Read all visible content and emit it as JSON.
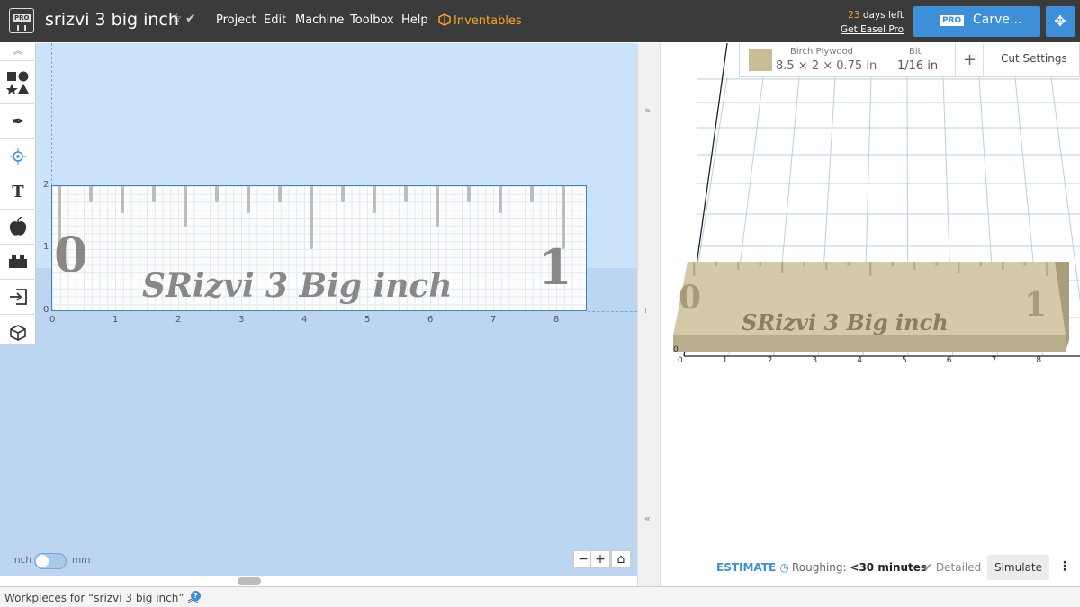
{
  "header": {
    "logo_badge": "PRO",
    "project_title": "srizvi 3 big inch",
    "menus": [
      "Project",
      "Edit",
      "Machine",
      "Toolbox",
      "Help"
    ],
    "inventables": "Inventables",
    "trial_days": "23",
    "trial_suffix": " days left",
    "get_pro": "Get Easel Pro",
    "carve_badge": "PRO",
    "carve_label": "Carve..."
  },
  "tools": [
    "shapes-icon",
    "pen-icon",
    "target-icon",
    "text-icon",
    "apps-icon",
    "lego-icon",
    "import-icon",
    "box-icon"
  ],
  "design": {
    "y_labels": [
      "2",
      "1",
      "0"
    ],
    "x_labels": [
      "0",
      "1",
      "2",
      "3",
      "4",
      "5",
      "6",
      "7",
      "8"
    ],
    "ruler_left_number": "0",
    "ruler_right_number": "1",
    "engraving_text": "SRizvi 3 Big inch",
    "unit_inch": "inch",
    "unit_mm": "mm"
  },
  "material": {
    "name": "Birch Plywood",
    "dimensions": "8.5 × 2 × 0.75 in",
    "bit_label": "Bit",
    "bit_value": "1/16 in",
    "cut_settings": "Cut Settings"
  },
  "preview": {
    "x_labels": [
      "0",
      "1",
      "2",
      "3",
      "4",
      "5",
      "6",
      "7",
      "8"
    ],
    "left_number": "0",
    "right_number": "1",
    "engraving_text": "SRizvi 3 Big inch"
  },
  "estimate": {
    "label": "ESTIMATE",
    "roughing_label": "Roughing:",
    "roughing_value": "<30 minutes",
    "detailed": "Detailed",
    "simulate": "Simulate"
  },
  "footer": {
    "workpieces_label": "Workpieces for “srizvi 3 big inch”"
  },
  "colors": {
    "accent": "#3d8fd8",
    "inventables": "#f5a623",
    "wood": "#c9bd98"
  }
}
